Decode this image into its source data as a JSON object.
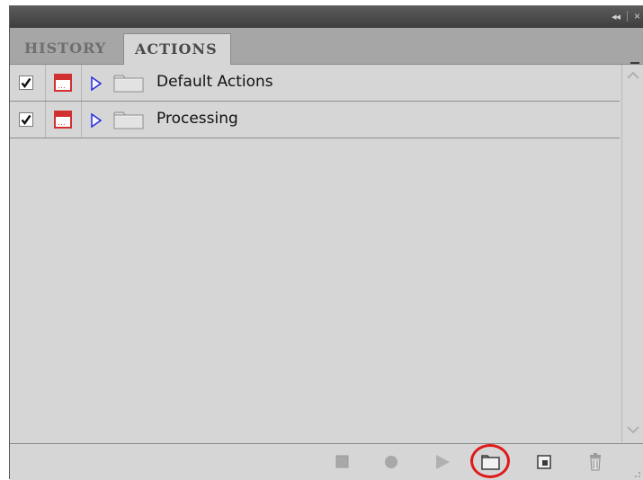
{
  "panel": {
    "tabs": [
      {
        "label": "HISTORY",
        "active": false
      },
      {
        "label": "ACTIONS",
        "active": true
      }
    ],
    "title_controls": {
      "collapse": "◂◂",
      "close": "×"
    }
  },
  "action_sets": [
    {
      "label": "Default Actions",
      "checked": true,
      "expanded": false
    },
    {
      "label": "Processing",
      "checked": true,
      "expanded": false
    }
  ],
  "bottom_buttons": [
    {
      "name": "stop",
      "icon": "stop-icon"
    },
    {
      "name": "record",
      "icon": "record-icon"
    },
    {
      "name": "play",
      "icon": "play-icon"
    },
    {
      "name": "new-set",
      "icon": "folder-icon",
      "highlighted": true
    },
    {
      "name": "new-action",
      "icon": "new-action-icon"
    },
    {
      "name": "delete",
      "icon": "trash-icon"
    }
  ],
  "colors": {
    "highlight": "#e01818",
    "dialog_toggle": "#d03030",
    "expander": "#2a2ae0"
  }
}
